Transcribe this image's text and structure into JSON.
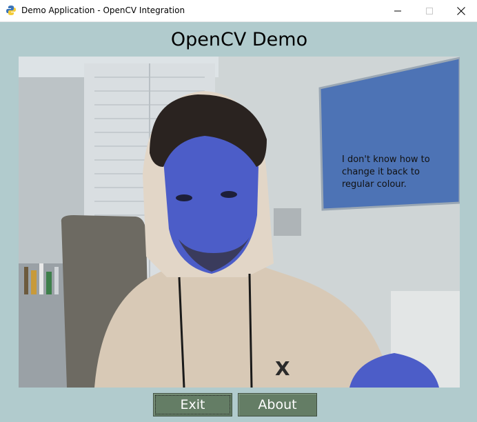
{
  "window": {
    "title": "Demo Application - OpenCV Integration",
    "icons": [
      "app-icon",
      "minimize-icon",
      "maximize-icon",
      "close-icon"
    ]
  },
  "app": {
    "heading": "OpenCV Demo"
  },
  "video": {
    "annotation": "I don't know how to change it back to regular colour."
  },
  "buttons": {
    "exit_label": "Exit",
    "about_label": "About"
  },
  "colors": {
    "background": "#b1cbcd",
    "button": "#647d65",
    "button_text": "#ffffff"
  }
}
